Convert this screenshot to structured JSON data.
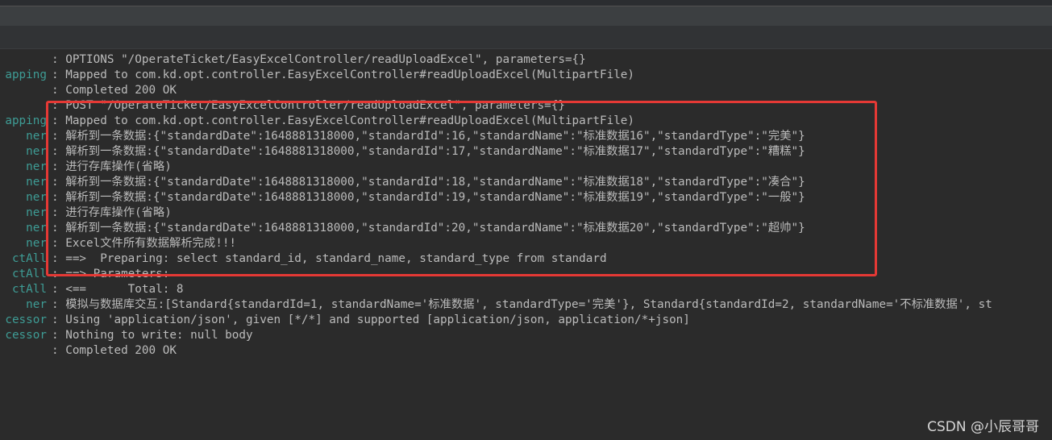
{
  "colors": {
    "background": "#2b2b2b",
    "text": "#bbbbbb",
    "logger": "#3e9c95",
    "highlight": "#e53935"
  },
  "console": {
    "lines": [
      {
        "logger": "",
        "message": ": OPTIONS \"/OperateTicket/EasyExcelController/readUploadExcel\", parameters={}"
      },
      {
        "logger": "apping",
        "message": ": Mapped to com.kd.opt.controller.EasyExcelController#readUploadExcel(MultipartFile)"
      },
      {
        "logger": "",
        "message": ": Completed 200 OK"
      },
      {
        "logger": "",
        "message": ": POST \"/OperateTicket/EasyExcelController/readUploadExcel\", parameters={}"
      },
      {
        "logger": "apping",
        "message": ": Mapped to com.kd.opt.controller.EasyExcelController#readUploadExcel(MultipartFile)"
      },
      {
        "logger": "ner",
        "message": ": 解析到一条数据:{\"standardDate\":1648881318000,\"standardId\":16,\"standardName\":\"标准数据16\",\"standardType\":\"完美\"}"
      },
      {
        "logger": "ner",
        "message": ": 解析到一条数据:{\"standardDate\":1648881318000,\"standardId\":17,\"standardName\":\"标准数据17\",\"standardType\":\"糟糕\"}"
      },
      {
        "logger": "ner",
        "message": ": 进行存库操作(省略)"
      },
      {
        "logger": "ner",
        "message": ": 解析到一条数据:{\"standardDate\":1648881318000,\"standardId\":18,\"standardName\":\"标准数据18\",\"standardType\":\"凑合\"}"
      },
      {
        "logger": "ner",
        "message": ": 解析到一条数据:{\"standardDate\":1648881318000,\"standardId\":19,\"standardName\":\"标准数据19\",\"standardType\":\"一般\"}"
      },
      {
        "logger": "ner",
        "message": ": 进行存库操作(省略)"
      },
      {
        "logger": "ner",
        "message": ": 解析到一条数据:{\"standardDate\":1648881318000,\"standardId\":20,\"standardName\":\"标准数据20\",\"standardType\":\"超帅\"}"
      },
      {
        "logger": "ner",
        "message": ": Excel文件所有数据解析完成!!!"
      },
      {
        "logger": "ctAll",
        "message": ": ==>  Preparing: select standard_id, standard_name, standard_type from standard"
      },
      {
        "logger": "ctAll",
        "message": ": ==> Parameters: "
      },
      {
        "logger": "ctAll",
        "message": ": <==      Total: 8"
      },
      {
        "logger": "ner",
        "message": ": 模拟与数据库交互:[Standard{standardId=1, standardName='标准数据', standardType='完美'}, Standard{standardId=2, standardName='不标准数据', st"
      },
      {
        "logger": "cessor",
        "message": ": Using 'application/json', given [*/*] and supported [application/json, application/*+json]"
      },
      {
        "logger": "cessor",
        "message": ": Nothing to write: null body"
      },
      {
        "logger": "",
        "message": ": Completed 200 OK"
      }
    ]
  },
  "watermark": "CSDN @小辰哥哥"
}
